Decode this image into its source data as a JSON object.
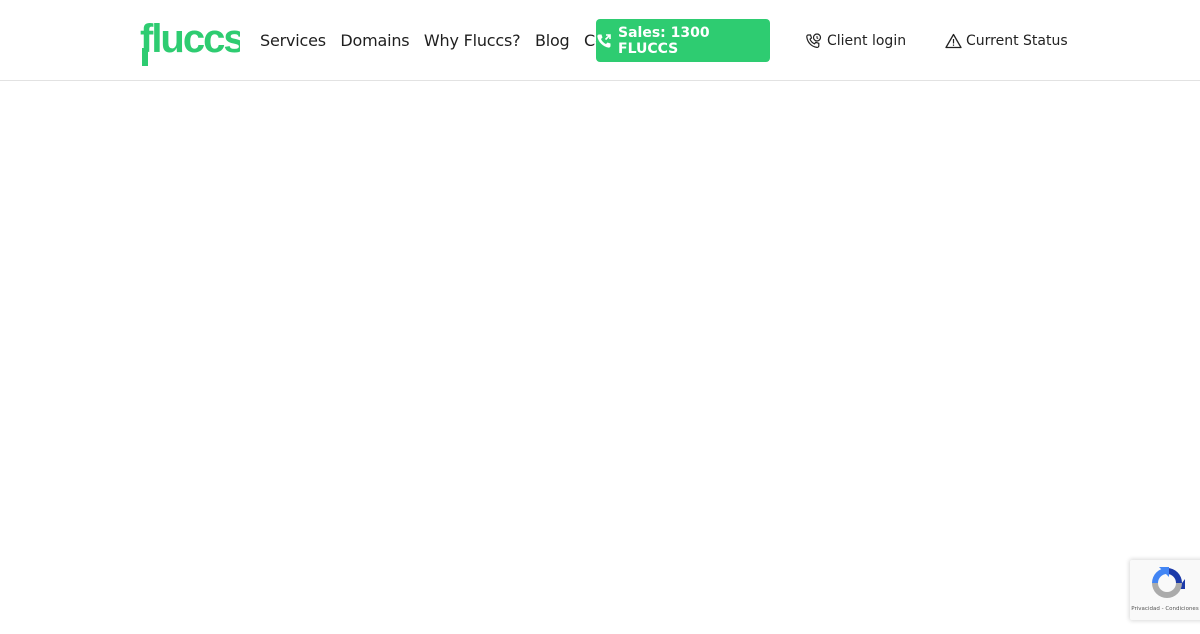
{
  "brand": {
    "name": "fluccs",
    "color": "#2ecc71"
  },
  "nav": {
    "items": [
      {
        "label": "Services"
      },
      {
        "label": "Domains"
      },
      {
        "label": "Why Fluccs?"
      },
      {
        "label": "Blog"
      },
      {
        "label": "Contact"
      }
    ]
  },
  "sales_button": {
    "label": "Sales: 1300 FLUCCS",
    "icon": "phone-call-icon"
  },
  "client_login": {
    "label": "Client login",
    "icon": "phone-support-icon"
  },
  "current_status": {
    "label": "Current Status",
    "icon": "warning-triangle-icon"
  },
  "recaptcha": {
    "terms": "Privacidad - Condiciones",
    "icon": "recaptcha-icon"
  }
}
